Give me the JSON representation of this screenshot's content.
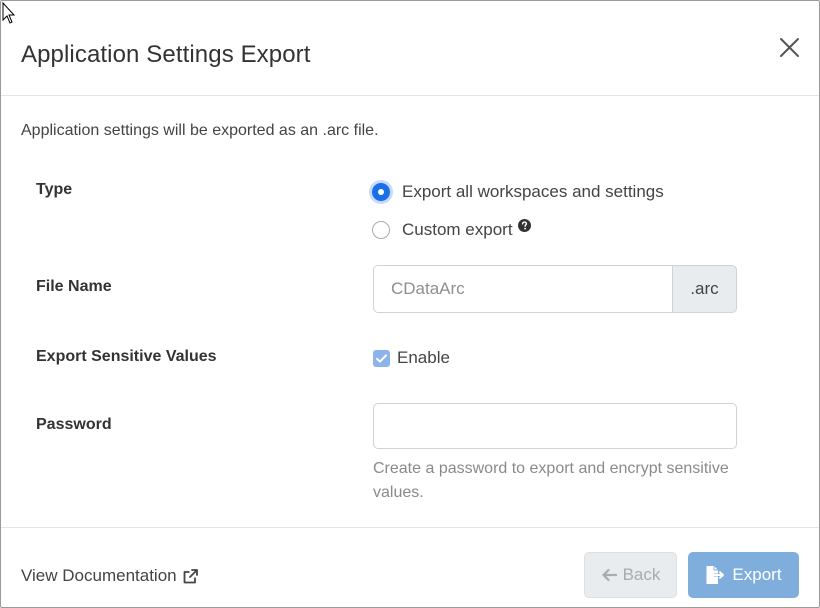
{
  "dialog": {
    "title": "Application Settings Export",
    "close_icon": "close-icon",
    "description": "Application settings will be exported as an .arc file."
  },
  "type": {
    "label": "Type",
    "options": [
      {
        "label": "Export all workspaces and settings",
        "selected": true
      },
      {
        "label": "Custom export",
        "selected": false,
        "icon": "question-circle-icon"
      }
    ]
  },
  "file_name": {
    "label": "File Name",
    "placeholder": "CDataArc",
    "value": "",
    "extension": ".arc"
  },
  "sensitive": {
    "label": "Export Sensitive Values",
    "checkbox_label": "Enable",
    "checked": true
  },
  "password": {
    "label": "Password",
    "value": "",
    "help": "Create a password to export and encrypt sensitive values."
  },
  "footer": {
    "doc_link": "View Documentation",
    "doc_icon": "external-link-icon",
    "back_label": "Back",
    "back_icon": "arrow-left-icon",
    "export_label": "Export",
    "export_icon": "file-export-icon"
  },
  "colors": {
    "primary": "#1a6fe6",
    "export_button": "#7faedd",
    "checkbox": "#8cb4ea",
    "addon_bg": "#e9ecef"
  }
}
